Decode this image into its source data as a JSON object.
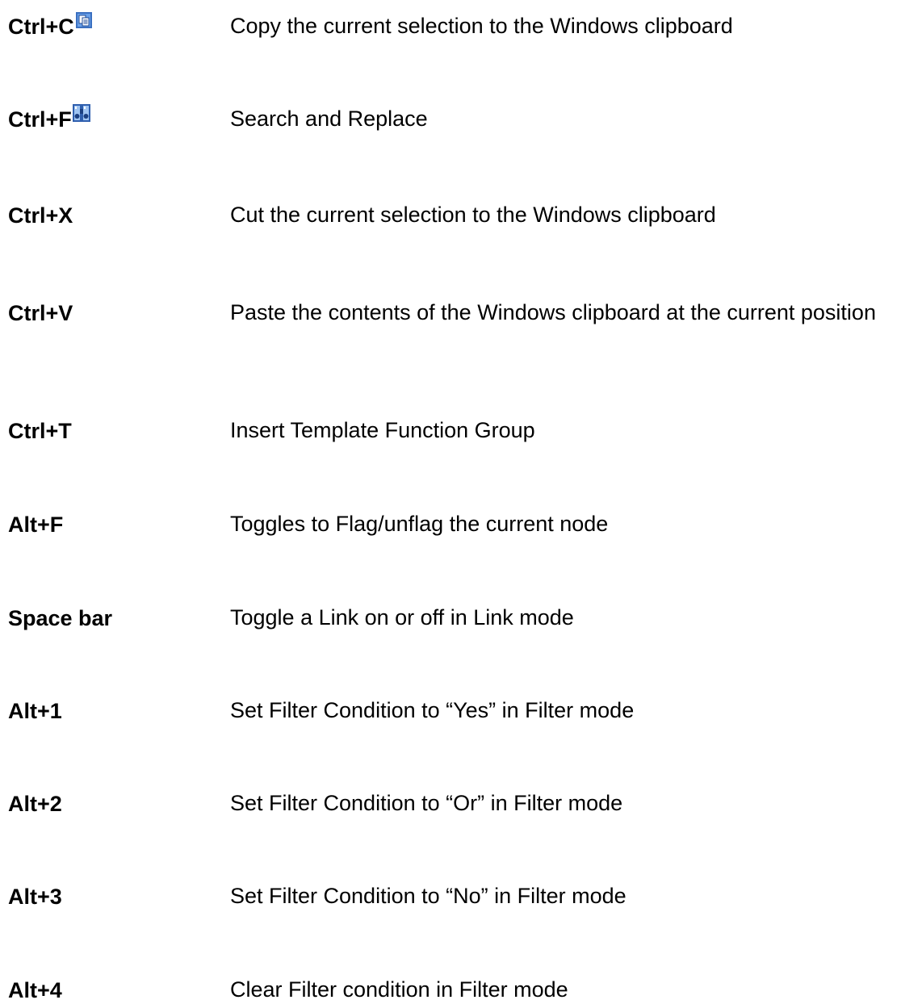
{
  "shortcuts": [
    {
      "key": "Ctrl+C",
      "icon": "copy-icon",
      "description": "Copy the current selection to the Windows clipboard"
    },
    {
      "key": "Ctrl+F",
      "icon": "binoculars-icon",
      "description": "Search and Replace"
    },
    {
      "key": "Ctrl+X",
      "description": "Cut the current selection to the Windows clipboard"
    },
    {
      "key": "Ctrl+V",
      "description": "Paste the contents of the Windows clipboard at the current position"
    },
    {
      "key": "Ctrl+T",
      "description": "Insert Template Function Group"
    },
    {
      "key": "Alt+F",
      "description": "Toggles to Flag/unflag the current node"
    },
    {
      "key": "Space bar",
      "description": "Toggle a Link on or off in Link mode"
    },
    {
      "key": "Alt+1",
      "description": "Set Filter Condition to “Yes” in Filter mode"
    },
    {
      "key": "Alt+2",
      "description": "Set Filter Condition to “Or” in Filter mode"
    },
    {
      "key": "Alt+3",
      "description": "Set Filter Condition to “No” in Filter mode"
    },
    {
      "key": "Alt+4",
      "description": "Clear Filter condition in Filter mode"
    }
  ]
}
